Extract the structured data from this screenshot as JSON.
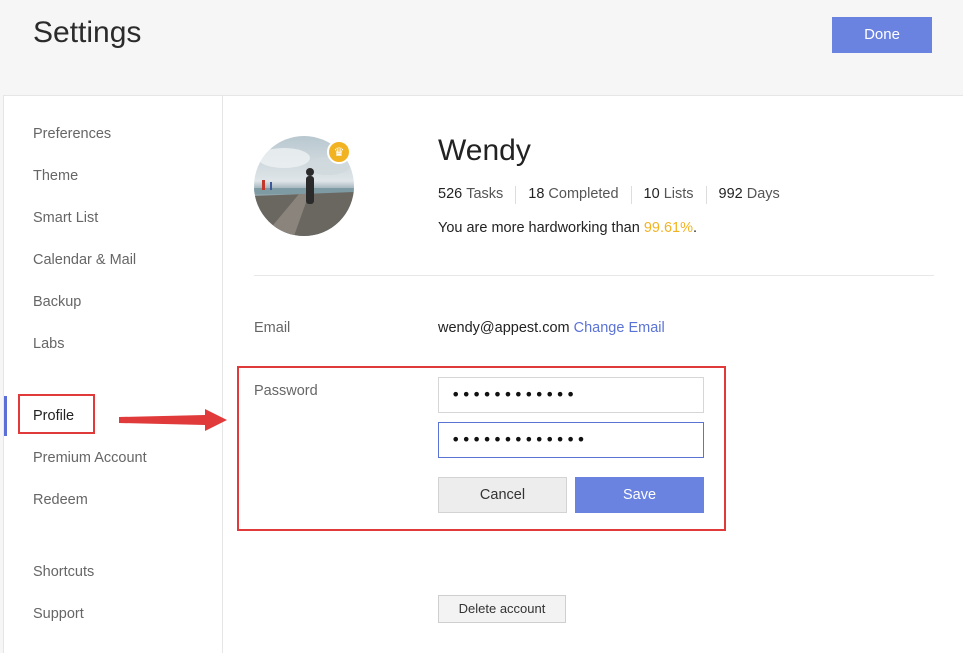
{
  "header": {
    "title": "Settings",
    "done_label": "Done"
  },
  "sidebar": {
    "items": [
      {
        "label": "Preferences"
      },
      {
        "label": "Theme"
      },
      {
        "label": "Smart List"
      },
      {
        "label": "Calendar & Mail"
      },
      {
        "label": "Backup"
      },
      {
        "label": "Labs"
      },
      {
        "label": "Profile",
        "active": true
      },
      {
        "label": "Premium Account"
      },
      {
        "label": "Redeem"
      },
      {
        "label": "Shortcuts"
      },
      {
        "label": "Support"
      }
    ]
  },
  "profile": {
    "name": "Wendy",
    "stats": [
      {
        "value": "526",
        "unit": "Tasks"
      },
      {
        "value": "18",
        "unit": "Completed"
      },
      {
        "value": "10",
        "unit": "Lists"
      },
      {
        "value": "992",
        "unit": "Days"
      }
    ],
    "hardworking_prefix": "You are more hardworking than ",
    "hardworking_percent": "99.61%",
    "hardworking_suffix": ".",
    "badge_icon": "crown-icon"
  },
  "account": {
    "email_label": "Email",
    "email_value": "wendy@appest.com",
    "change_email_label": "Change Email",
    "password_label": "Password",
    "password_value_1": "••••••••••••",
    "password_value_2": "•••••••••••••",
    "cancel_label": "Cancel",
    "save_label": "Save",
    "delete_label": "Delete account"
  },
  "colors": {
    "accent": "#6a83e0",
    "link": "#5b73d6",
    "highlight": "#e03a3a",
    "gold": "#f2b323"
  }
}
